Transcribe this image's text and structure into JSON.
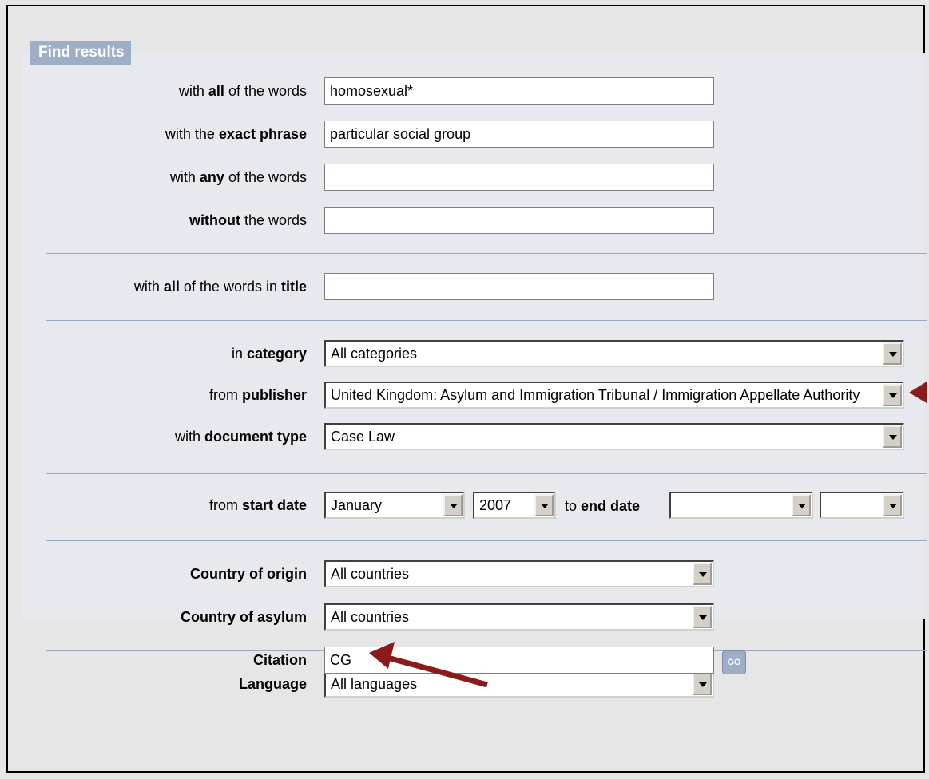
{
  "legend": "Find results",
  "fields": {
    "all_words": {
      "label_pre": "with ",
      "label_bold": "all",
      "label_post": " of the words",
      "value": "homosexual*"
    },
    "exact_phrase": {
      "label_pre": "with the ",
      "label_bold": "exact phrase",
      "label_post": "",
      "value": "particular social group"
    },
    "any_words": {
      "label_pre": "with ",
      "label_bold": "any",
      "label_post": " of the words",
      "value": ""
    },
    "without_words": {
      "label_pre": "",
      "label_bold": "without",
      "label_post": " the words",
      "value": ""
    },
    "title_words": {
      "label_pre": "with ",
      "label_bold": "all",
      "label_mid": " of the words in ",
      "label_bold2": "title",
      "value": ""
    }
  },
  "selects": {
    "category": {
      "label_pre": "in ",
      "label_bold": "category",
      "value": "All categories"
    },
    "publisher": {
      "label_pre": "from ",
      "label_bold": "publisher",
      "value": "United Kingdom: Asylum and Immigration Tribunal / Immigration Appellate Authority"
    },
    "doctype": {
      "label_pre": "with ",
      "label_bold": "document type",
      "value": "Case Law"
    },
    "start_date": {
      "label_pre": "from ",
      "label_bold": "start date",
      "month": "January",
      "year": "2007"
    },
    "end_date": {
      "label_pre": "to ",
      "label_bold": "end date",
      "month": "",
      "year": ""
    },
    "origin": {
      "label_bold": "Country of origin",
      "value": "All countries"
    },
    "asylum": {
      "label_bold": "Country of asylum",
      "value": "All countries"
    },
    "language": {
      "label_bold": "Language",
      "value": "All languages"
    }
  },
  "citation": {
    "label_bold": "Citation",
    "value": "CG"
  },
  "go_button": "GO",
  "colors": {
    "legend_bg": "#9eaec8",
    "arrow": "#8b1a1a"
  }
}
